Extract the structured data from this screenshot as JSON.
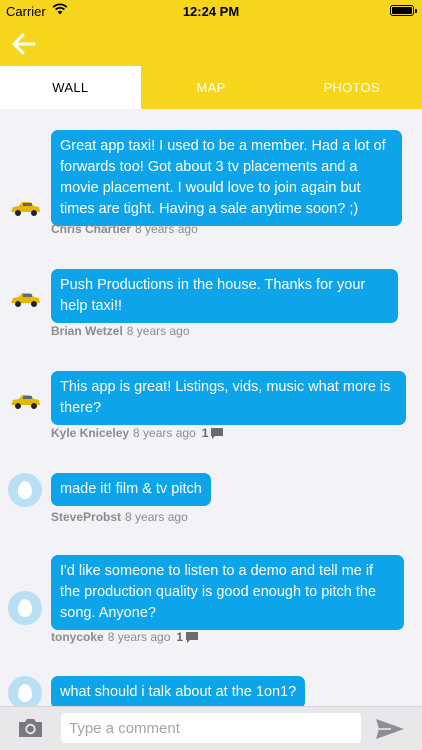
{
  "status_bar": {
    "carrier": "Carrier",
    "time": "12:24 PM"
  },
  "nav": {
    "back_icon": "arrow-left-icon"
  },
  "tabs": [
    {
      "label": "WALL",
      "active": true
    },
    {
      "label": "MAP",
      "active": false
    },
    {
      "label": "PHOTOS",
      "active": false
    }
  ],
  "posts": [
    {
      "author": "Chris Chartier",
      "time": "8 years ago",
      "avatar": "taxi-car-icon",
      "message": "Great app taxi! I used to be a member. Had a lot of forwards too! Got about 3 tv placements and a movie placement. I would love to join again but times are tight. Having a sale anytime soon? ;)",
      "comments": null
    },
    {
      "author": "Brian Wetzel",
      "time": "8 years ago",
      "avatar": "taxi-car-icon",
      "message": "Push Productions in the house.  Thanks for your help taxi!!",
      "comments": null
    },
    {
      "author": "Kyle Kniceley",
      "time": "8 years ago",
      "avatar": "taxi-car-icon",
      "message": "This app is great!  Listings, vids, music what more is there?",
      "comments": "1"
    },
    {
      "author": "SteveProbst",
      "time": "8 years ago",
      "avatar": "egg-avatar-icon",
      "message": "made it! film & tv pitch",
      "comments": null
    },
    {
      "author": "tonycoke",
      "time": "8 years ago",
      "avatar": "egg-avatar-icon",
      "message": "I'd like someone to listen to a demo and tell me if the production quality is good enough to pitch the song. Anyone?",
      "comments": "1"
    },
    {
      "author": "",
      "time": "",
      "avatar": "egg-avatar-icon",
      "message": "what should i talk about at the 1on1?",
      "comments": null
    }
  ],
  "composer": {
    "placeholder": "Type a comment",
    "camera_icon": "camera-icon",
    "send_icon": "send-icon"
  },
  "colors": {
    "brand_yellow": "#f6d51d",
    "bubble_blue": "#0ea4ea",
    "background": "#f2f2f7"
  }
}
